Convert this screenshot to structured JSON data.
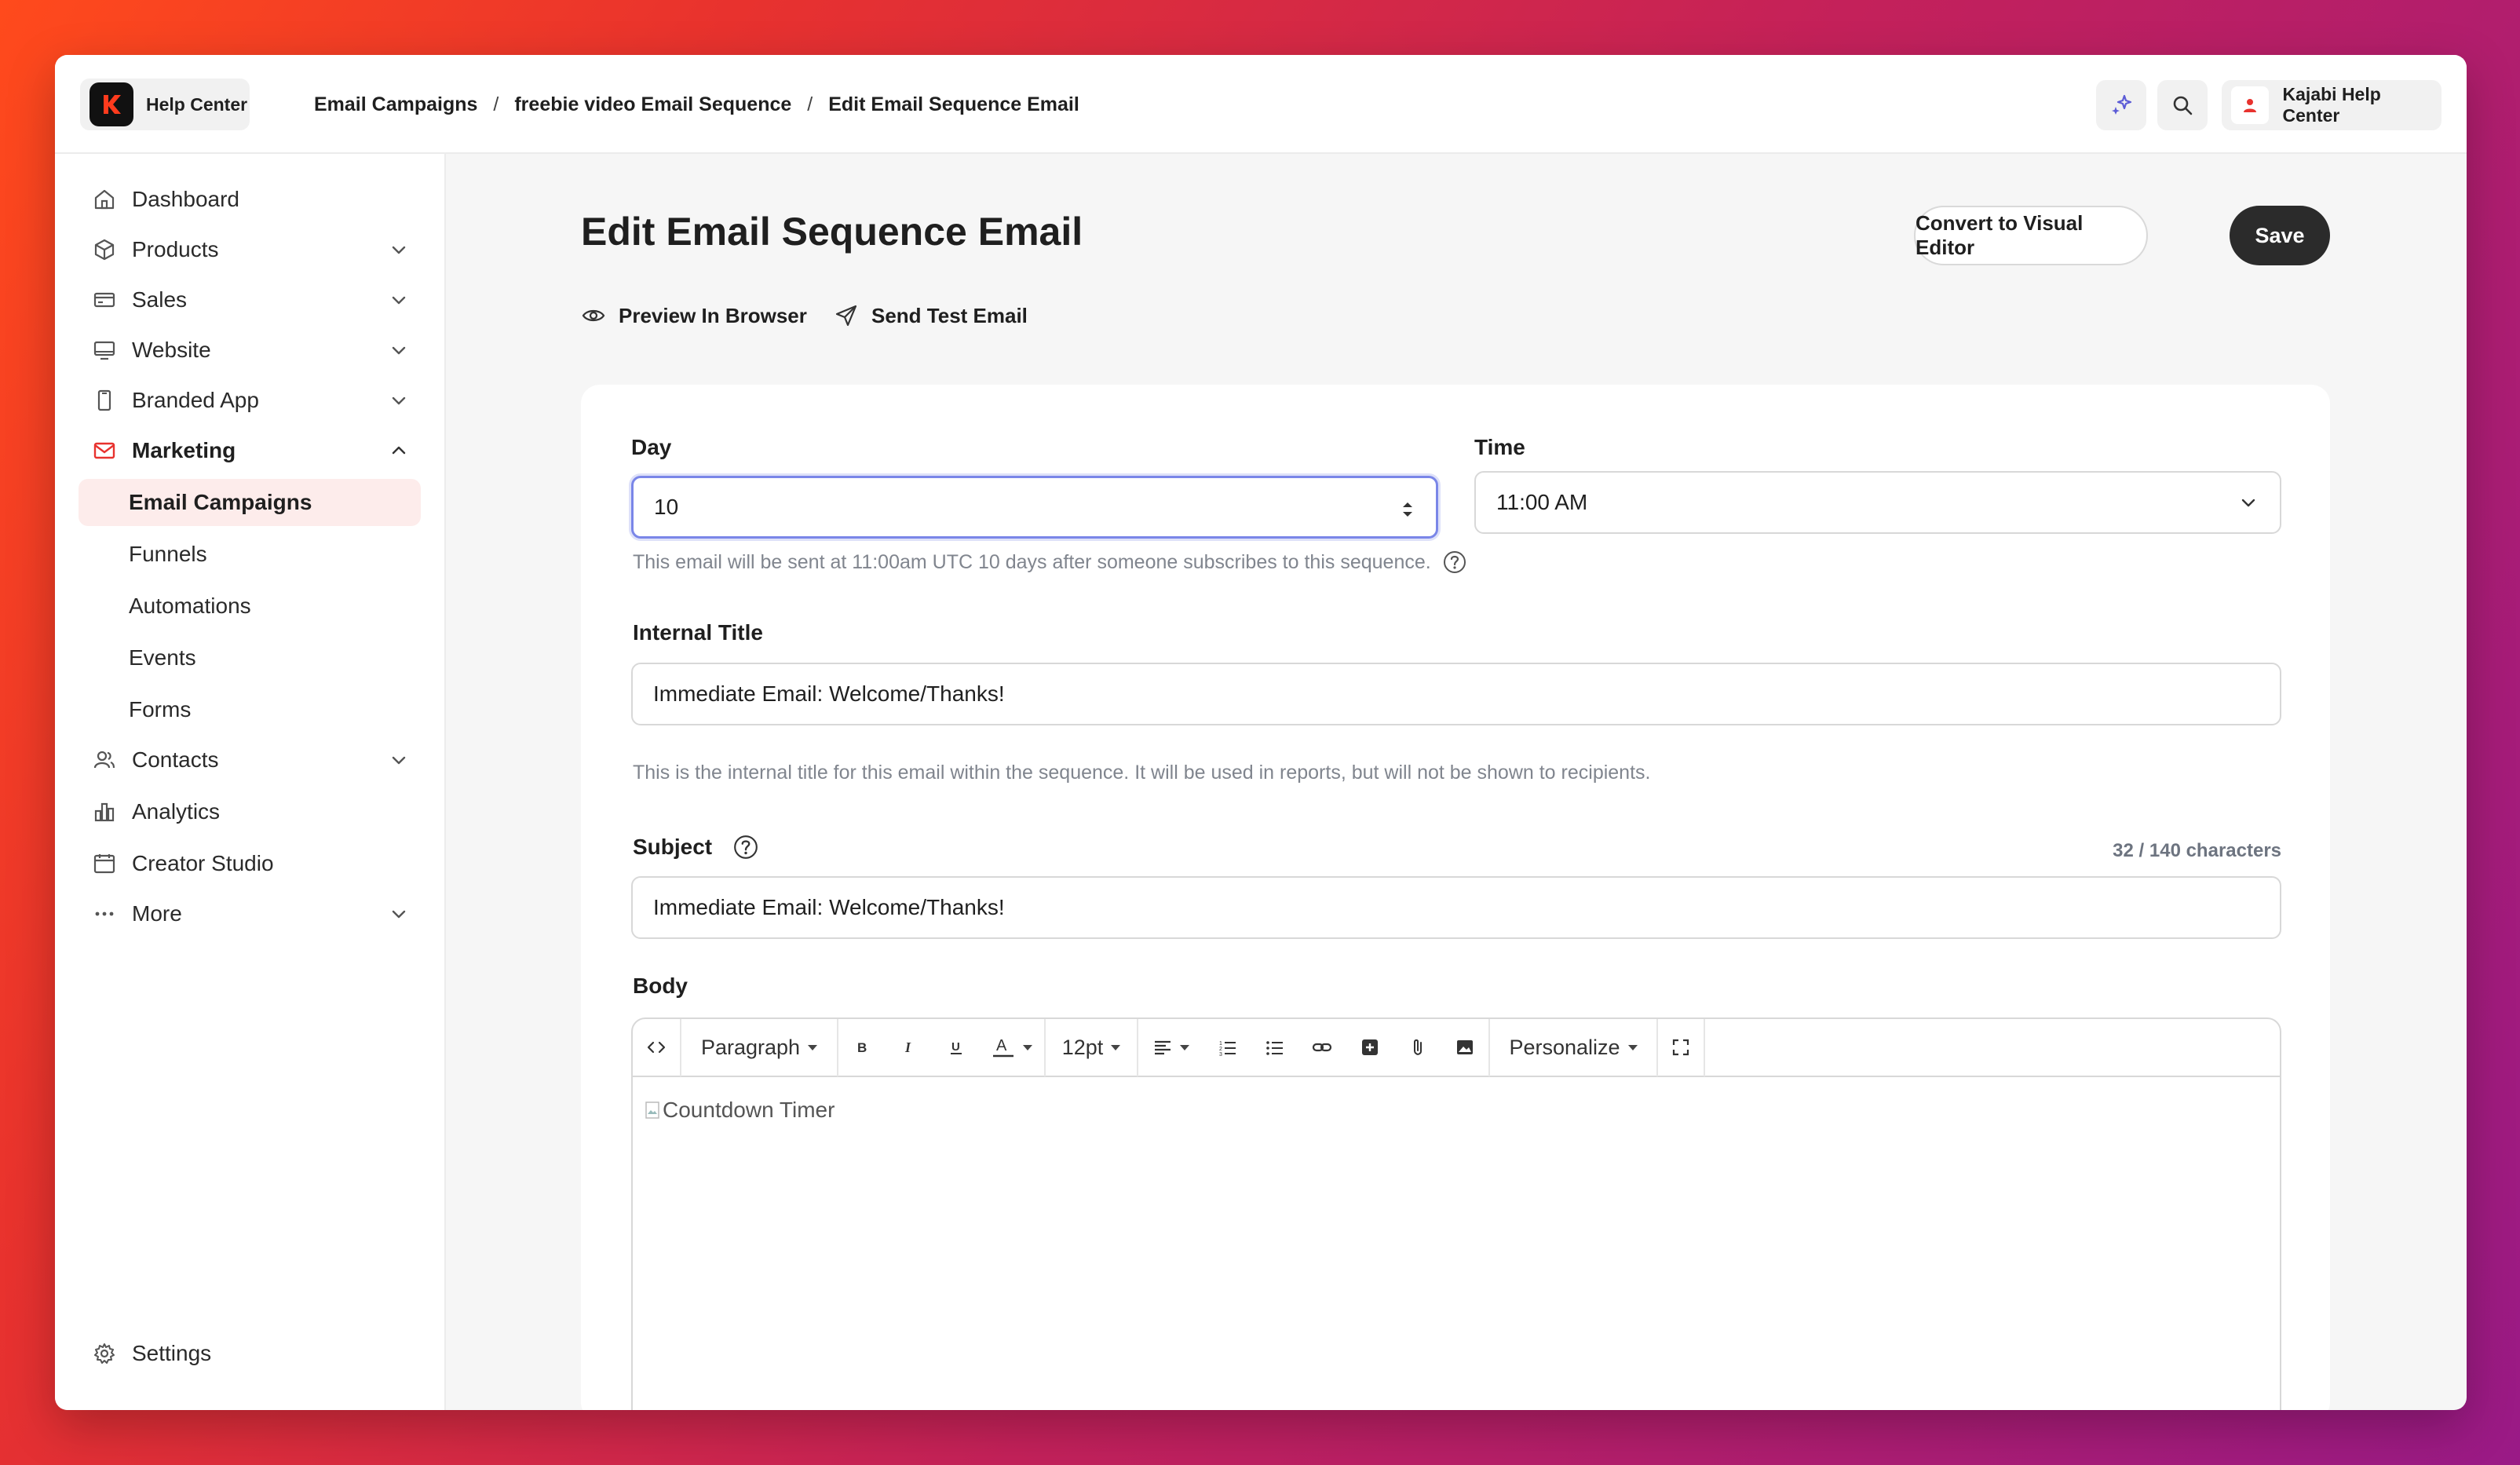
{
  "topbar": {
    "help_center_label": "Help Center",
    "breadcrumb": [
      "Email Campaigns",
      "freebie video Email Sequence",
      "Edit Email Sequence Email"
    ],
    "account_label": "Kajabi Help Center"
  },
  "sidebar": {
    "items": [
      {
        "label": "Dashboard"
      },
      {
        "label": "Products"
      },
      {
        "label": "Sales"
      },
      {
        "label": "Website"
      },
      {
        "label": "Branded App"
      },
      {
        "label": "Marketing"
      },
      {
        "label": "Email Campaigns"
      },
      {
        "label": "Funnels"
      },
      {
        "label": "Automations"
      },
      {
        "label": "Events"
      },
      {
        "label": "Forms"
      },
      {
        "label": "Contacts"
      },
      {
        "label": "Analytics"
      },
      {
        "label": "Creator Studio"
      },
      {
        "label": "More"
      },
      {
        "label": "Settings"
      }
    ]
  },
  "page": {
    "title": "Edit Email Sequence Email",
    "convert_label": "Convert to Visual Editor",
    "save_label": "Save",
    "preview_label": "Preview In Browser",
    "send_test_label": "Send Test Email"
  },
  "form": {
    "day_label": "Day",
    "day_value": "10",
    "time_label": "Time",
    "time_value": "11:00 AM",
    "schedule_help": "This email will be sent at 11:00am UTC 10 days after someone subscribes to this sequence.",
    "internal_title_label": "Internal Title",
    "internal_title_value": "Immediate Email: Welcome/Thanks!",
    "internal_title_help": "This is the internal title for this email within the sequence. It will be used in reports, but will not be shown to recipients.",
    "subject_label": "Subject",
    "subject_counter": "32 / 140 characters",
    "subject_value": "Immediate Email: Welcome/Thanks!",
    "body_label": "Body"
  },
  "editor": {
    "paragraph_label": "Paragraph",
    "font_size_label": "12pt",
    "personalize_label": "Personalize",
    "content_alt": "Countdown Timer"
  },
  "colors": {
    "accent_red": "#e8322e",
    "active_bg": "#fdeceb",
    "focus_ring": "#7a86e8",
    "save_bg": "#2b2b2b"
  }
}
